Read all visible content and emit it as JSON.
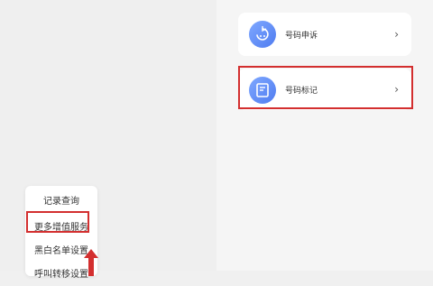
{
  "menu": {
    "items": [
      "记录查询",
      "更多增值服务",
      "黑白名单设置",
      "呼叫转移设置"
    ]
  },
  "services": [
    {
      "label": "号码申诉",
      "icon": "phone-return-icon"
    },
    {
      "label": "号码标记",
      "icon": "note-tag-icon"
    }
  ],
  "chevron": "›",
  "colors": {
    "highlight": "#d32f2f",
    "accent": "#5b86f5"
  }
}
